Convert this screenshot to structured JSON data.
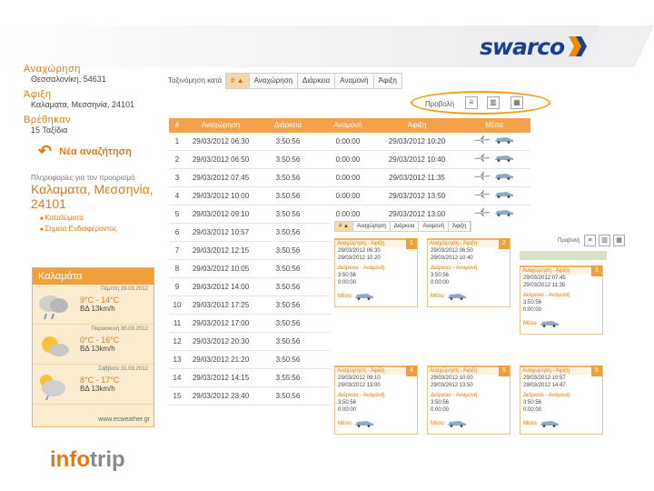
{
  "header": {
    "brand": "swarco"
  },
  "left": {
    "departure_label": "Αναχώρηση",
    "departure_value": "Θεσσαλονίκη, 54631",
    "arrival_label": "Άφιξη",
    "arrival_value": "Καλαματα, Μεσσηνία, 24101",
    "found_label": "Βρέθηκαν",
    "found_value": "15 Ταξίδια",
    "new_search": "Νέα αναζήτηση",
    "info_text": "Πληροφορίες για τον προορισμό",
    "city": "Καλαματα, Μεσσηνία, 24101",
    "bullets": [
      "Καταλύματα",
      "Σημεία Ενδιαφέροντος"
    ]
  },
  "weather": {
    "title": "Καλαμάτα",
    "days": [
      {
        "date": "Πέμπτη 29.03.2012",
        "temps": "9°C  -  14°C",
        "wind": "ΒΔ  13km/h"
      },
      {
        "date": "Παρασκευή 30.03.2012",
        "temps": "0°C  -  16°C",
        "wind": "ΒΔ  13km/h"
      },
      {
        "date": "Σάββατο 31.03.2012",
        "temps": "8°C  -  17°C",
        "wind": "ΒΔ  13km/h"
      }
    ],
    "footer": "www.ecweather.gr"
  },
  "logo": {
    "a": "info",
    "b": "trip"
  },
  "sort": {
    "label": "Ταξινόμηση κατά",
    "tabs": [
      "# ▲",
      "Αναχώρηση",
      "Διάρκεια",
      "Αναμονή",
      "Άφιξη"
    ]
  },
  "view": {
    "label": "Προβολή"
  },
  "table": {
    "headers": [
      "#",
      "Αναχώρηση",
      "Διάρκεια",
      "Αναμονή",
      "Άφιξη",
      "Μέσα"
    ],
    "rows": [
      [
        "1",
        "29/03/2012 06:30",
        "3:50:56",
        "0:00:00",
        "29/03/2012 10:20"
      ],
      [
        "2",
        "29/03/2012 06:50",
        "3:50:56",
        "0:00:00",
        "29/03/2012 10:40"
      ],
      [
        "3",
        "29/03/2012 07:45",
        "3:50:56",
        "0:00:00",
        "29/03/2012 11:35"
      ],
      [
        "4",
        "29/03/2012 10:00",
        "3:50:56",
        "0:00:00",
        "29/03/2012 13:50"
      ],
      [
        "5",
        "29/03/2012 09:10",
        "3:50:56",
        "0:00:00",
        "29/03/2012 13:00"
      ],
      [
        "6",
        "29/03/2012 10:57",
        "3:50:56",
        "0:00:00",
        ""
      ],
      [
        "7",
        "29/03/2012 12:15",
        "3:50:56",
        "0:00:00",
        ""
      ],
      [
        "8",
        "29/03/2012 10:05",
        "3:50:56",
        "0:00:00",
        ""
      ],
      [
        "9",
        "29/03/2012 14:00",
        "3:50:56",
        "0:00:00",
        ""
      ],
      [
        "10",
        "29/03/2012 17:25",
        "3:50:56",
        "0:00:00",
        ""
      ],
      [
        "11",
        "29/03/2012 17:00",
        "3:50:56",
        "0:00:00",
        ""
      ],
      [
        "12",
        "29/03/2012 20:30",
        "3:50:56",
        "0:00:00",
        ""
      ],
      [
        "13",
        "29/03/2012 21:20",
        "3:50:56",
        "0:00:00",
        ""
      ],
      [
        "14",
        "29/03/2012 14:15",
        "3:55:56",
        "0:00:00",
        ""
      ],
      [
        "15",
        "29/03/2012 23:40",
        "3:50:56",
        "0:00:00",
        ""
      ]
    ]
  },
  "overlay": {
    "tabs": [
      "# ▲",
      "Αναχώρηση",
      "Διάρκεια",
      "Αναμονή",
      "Άφιξη"
    ],
    "view_label": "Προβολή",
    "cards": [
      {
        "num": "1",
        "head": "Αναχώρηση - Άφιξη",
        "dep": "29/03/2012 06:30",
        "arr": "29/03/2012 10:20",
        "dur_label": "Διάρκεια - Αναμονή",
        "dur": "3:50:56",
        "wait": "0:00:00",
        "means": "Μέσα"
      },
      {
        "num": "2",
        "head": "Αναχώρηση - Άφιξη",
        "dep": "29/03/2012 06:50",
        "arr": "29/03/2012 10:40",
        "dur_label": "Διάρκεια - Αναμονή",
        "dur": "3:50:56",
        "wait": "0:00:00",
        "means": "Μέσα"
      },
      {
        "num": "3",
        "head": "Αναχώρηση - Άφιξη",
        "dep": "29/03/2012 07:45",
        "arr": "29/03/2012 11:35",
        "dur_label": "Διάρκεια - Αναμονή",
        "dur": "3:50:56",
        "wait": "0:00:00",
        "means": "Μέσα"
      },
      {
        "num": "4",
        "head": "Αναχώρηση - Άφιξη",
        "dep": "29/03/2012 09:10",
        "arr": "29/03/2012 13:00",
        "dur_label": "Διάρκεια - Αναμονή",
        "dur": "3:50:56",
        "wait": "0:00:00",
        "means": "Μέσα"
      },
      {
        "num": "5",
        "head": "Αναχώρηση - Άφιξη",
        "dep": "29/03/2012 10:00",
        "arr": "29/03/2012 13:50",
        "dur_label": "Διάρκεια - Αναμονή",
        "dur": "3:50:56",
        "wait": "0:00:00",
        "means": "Μέσα"
      },
      {
        "num": "6",
        "head": "Αναχώρηση - Άφιξη",
        "dep": "29/03/2012 10:57",
        "arr": "29/03/2012 14:47",
        "dur_label": "Διάρκεια - Αναμονή",
        "dur": "3:50:56",
        "wait": "0:00:00",
        "means": "Μέσα"
      }
    ]
  }
}
